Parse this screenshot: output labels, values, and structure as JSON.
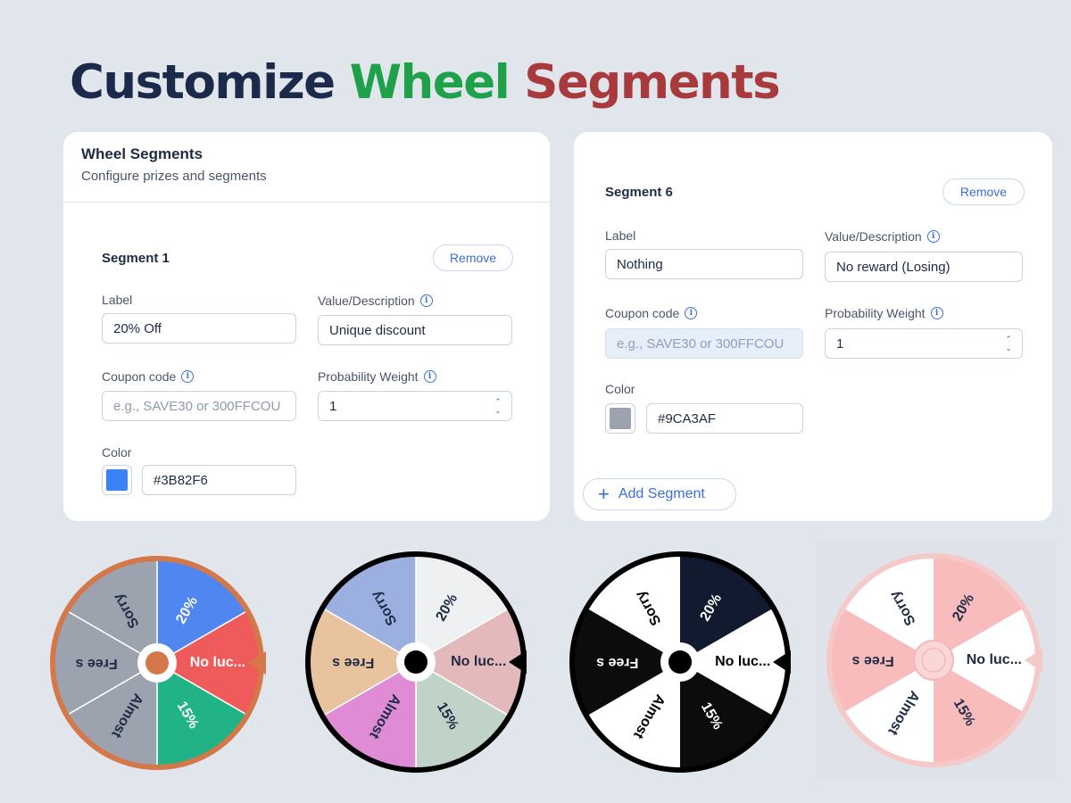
{
  "headline": {
    "part1": "Customize",
    "part1_color": "#1b2a4a",
    "part2": "Wheel",
    "part2_color": "#1fa14a",
    "part3": "Segments",
    "part3_color": "#a83a3e"
  },
  "left_card": {
    "title": "Wheel Segments",
    "subtitle": "Configure prizes and segments",
    "segment": {
      "title": "Segment 1",
      "remove": "Remove",
      "label_label": "Label",
      "label_value": "20% Off",
      "value_label": "Value/Description",
      "value_value": "Unique discount",
      "coupon_label": "Coupon code",
      "coupon_placeholder": "e.g., SAVE30 or 300FFCOU",
      "weight_label": "Probability Weight",
      "weight_value": "1",
      "color_label": "Color",
      "color_value": "#3B82F6",
      "swatch": "#3b82f6"
    }
  },
  "right_card": {
    "segment": {
      "title": "Segment 6",
      "remove": "Remove",
      "label_label": "Label",
      "label_value": "Nothing",
      "value_label": "Value/Description",
      "value_value": "No reward (Losing)",
      "coupon_label": "Coupon code",
      "coupon_placeholder": "e.g., SAVE30 or 300FFCOU",
      "weight_label": "Probability Weight",
      "weight_value": "1",
      "color_label": "Color",
      "color_value": "#9CA3AF",
      "swatch": "#9ca3af"
    },
    "add_segment": "Add Segment"
  },
  "info_icon": "info-icon",
  "wheel_labels": [
    "20%",
    "No luc...",
    "15%",
    "Almost",
    "Free s",
    "Sorry"
  ],
  "wheels": [
    {
      "name": "wheel-colorful",
      "rim": "#d4784a",
      "hub_ring": "#ffffff",
      "hub_center": "#d4784a",
      "pointer": "#d4784a",
      "text_color": "#ffffff",
      "segments": [
        "#4f86ef",
        "#ef5b5b",
        "#21b386",
        "#9ca3af",
        "#9ca3af",
        "#9ca3af"
      ],
      "text_colors": [
        "#ffffff",
        "#ffffff",
        "#ffffff",
        "#1f2a44",
        "#1f2a44",
        "#1f2a44"
      ]
    },
    {
      "name": "wheel-pastel",
      "rim": "#000000",
      "hub_ring": "#ffffff",
      "hub_center": "#000000",
      "pointer": "#000000",
      "segments": [
        "#eef0f2",
        "#e3b9bb",
        "#bfd3c9",
        "#df8bd6",
        "#e8c39e",
        "#9cb0e0"
      ],
      "text_colors": [
        "#1f2a44",
        "#1f2a44",
        "#1f2a44",
        "#1f2a44",
        "#1f2a44",
        "#1f2a44"
      ]
    },
    {
      "name": "wheel-dark",
      "rim": "#000000",
      "hub_ring": "#ffffff",
      "hub_center": "#000000",
      "pointer": "#000000",
      "segments": [
        "#111a2e",
        "#ffffff",
        "#0c0c0c",
        "#ffffff",
        "#0c0c0c",
        "#ffffff"
      ],
      "text_colors": [
        "#ffffff",
        "#000000",
        "#ffffff",
        "#000000",
        "#ffffff",
        "#000000"
      ]
    },
    {
      "name": "wheel-pink",
      "rim": "#f6c9c9",
      "hub_ring": "#fbd6d6",
      "hub_center": "#fbd6d6",
      "pointer": "#f6c9c9",
      "segments": [
        "#f8bcbc",
        "#ffffff",
        "#f8bcbc",
        "#ffffff",
        "#f8bcbc",
        "#ffffff"
      ],
      "text_colors": [
        "#1f2a44",
        "#1f2a44",
        "#1f2a44",
        "#1f2a44",
        "#1f2a44",
        "#1f2a44"
      ]
    }
  ]
}
